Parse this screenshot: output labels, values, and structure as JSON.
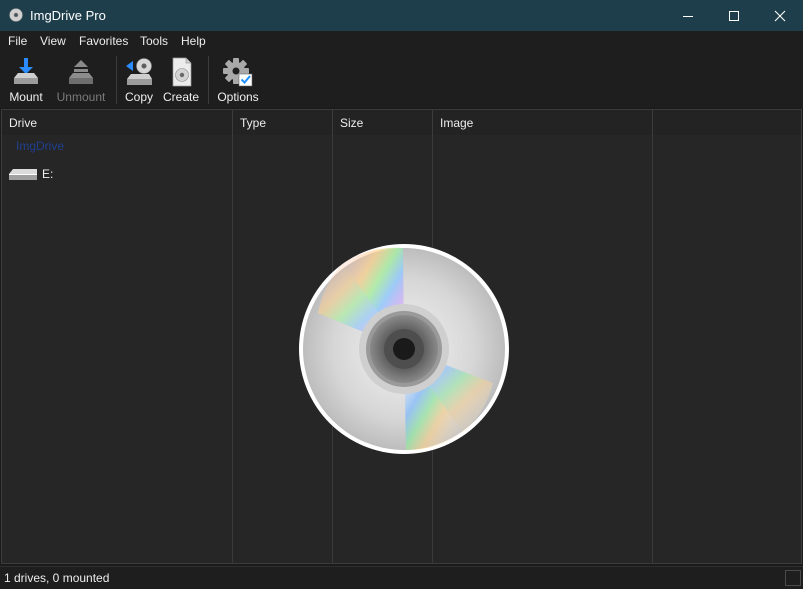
{
  "window": {
    "title": "ImgDrive Pro",
    "controls": [
      "minimize",
      "maximize",
      "close"
    ]
  },
  "menu": {
    "items": [
      "File",
      "View",
      "Favorites",
      "Tools",
      "Help"
    ]
  },
  "toolbar": {
    "buttons": [
      {
        "label": "Mount",
        "icon": "mount-icon",
        "enabled": true
      },
      {
        "label": "Unmount",
        "icon": "unmount-icon",
        "enabled": false
      },
      {
        "label": "Copy",
        "icon": "copy-icon",
        "enabled": true
      },
      {
        "label": "Create",
        "icon": "create-icon",
        "enabled": true
      },
      {
        "label": "Options",
        "icon": "options-icon",
        "enabled": true
      }
    ]
  },
  "drives_list": {
    "columns": [
      "Drive",
      "Type",
      "Size",
      "Image"
    ],
    "group": "ImgDrive",
    "rows": [
      {
        "drive": "E:",
        "type": "",
        "size": "",
        "image": ""
      }
    ]
  },
  "status": {
    "text": "1 drives, 0 mounted"
  },
  "colors": {
    "titlebar": "#1f3e4b",
    "background": "#262626",
    "group_label": "#1f3f8f",
    "accent_blue": "#1e90ff"
  }
}
